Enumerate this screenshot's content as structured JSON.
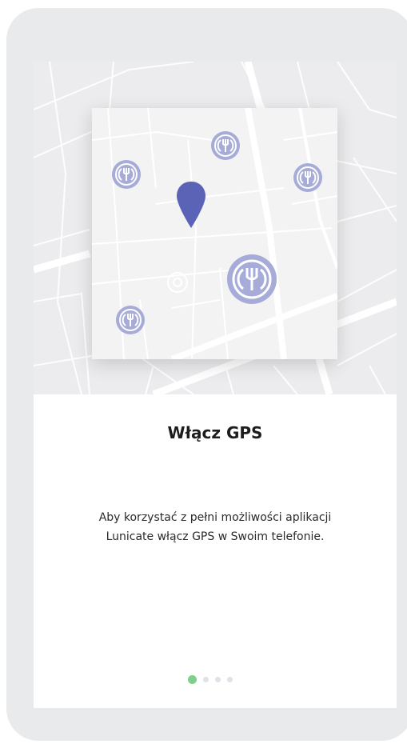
{
  "onboarding": {
    "title": "Włącz GPS",
    "description_line1": "Aby korzystać z pełni możliwości aplikacji",
    "description_line2": "Lunicate włącz GPS w Swoim telefonie.",
    "page_indicator": {
      "total": 4,
      "active_index": 0
    }
  },
  "icons": {
    "location_pin": "map-pin-icon",
    "restaurant": "fork-restaurant-icon"
  },
  "colors": {
    "accent_purple": "#5b63b7",
    "restaurant_marker": "#a6abd8",
    "active_dot": "#7fcf8a",
    "inactive_dot": "#dfe3e8"
  }
}
